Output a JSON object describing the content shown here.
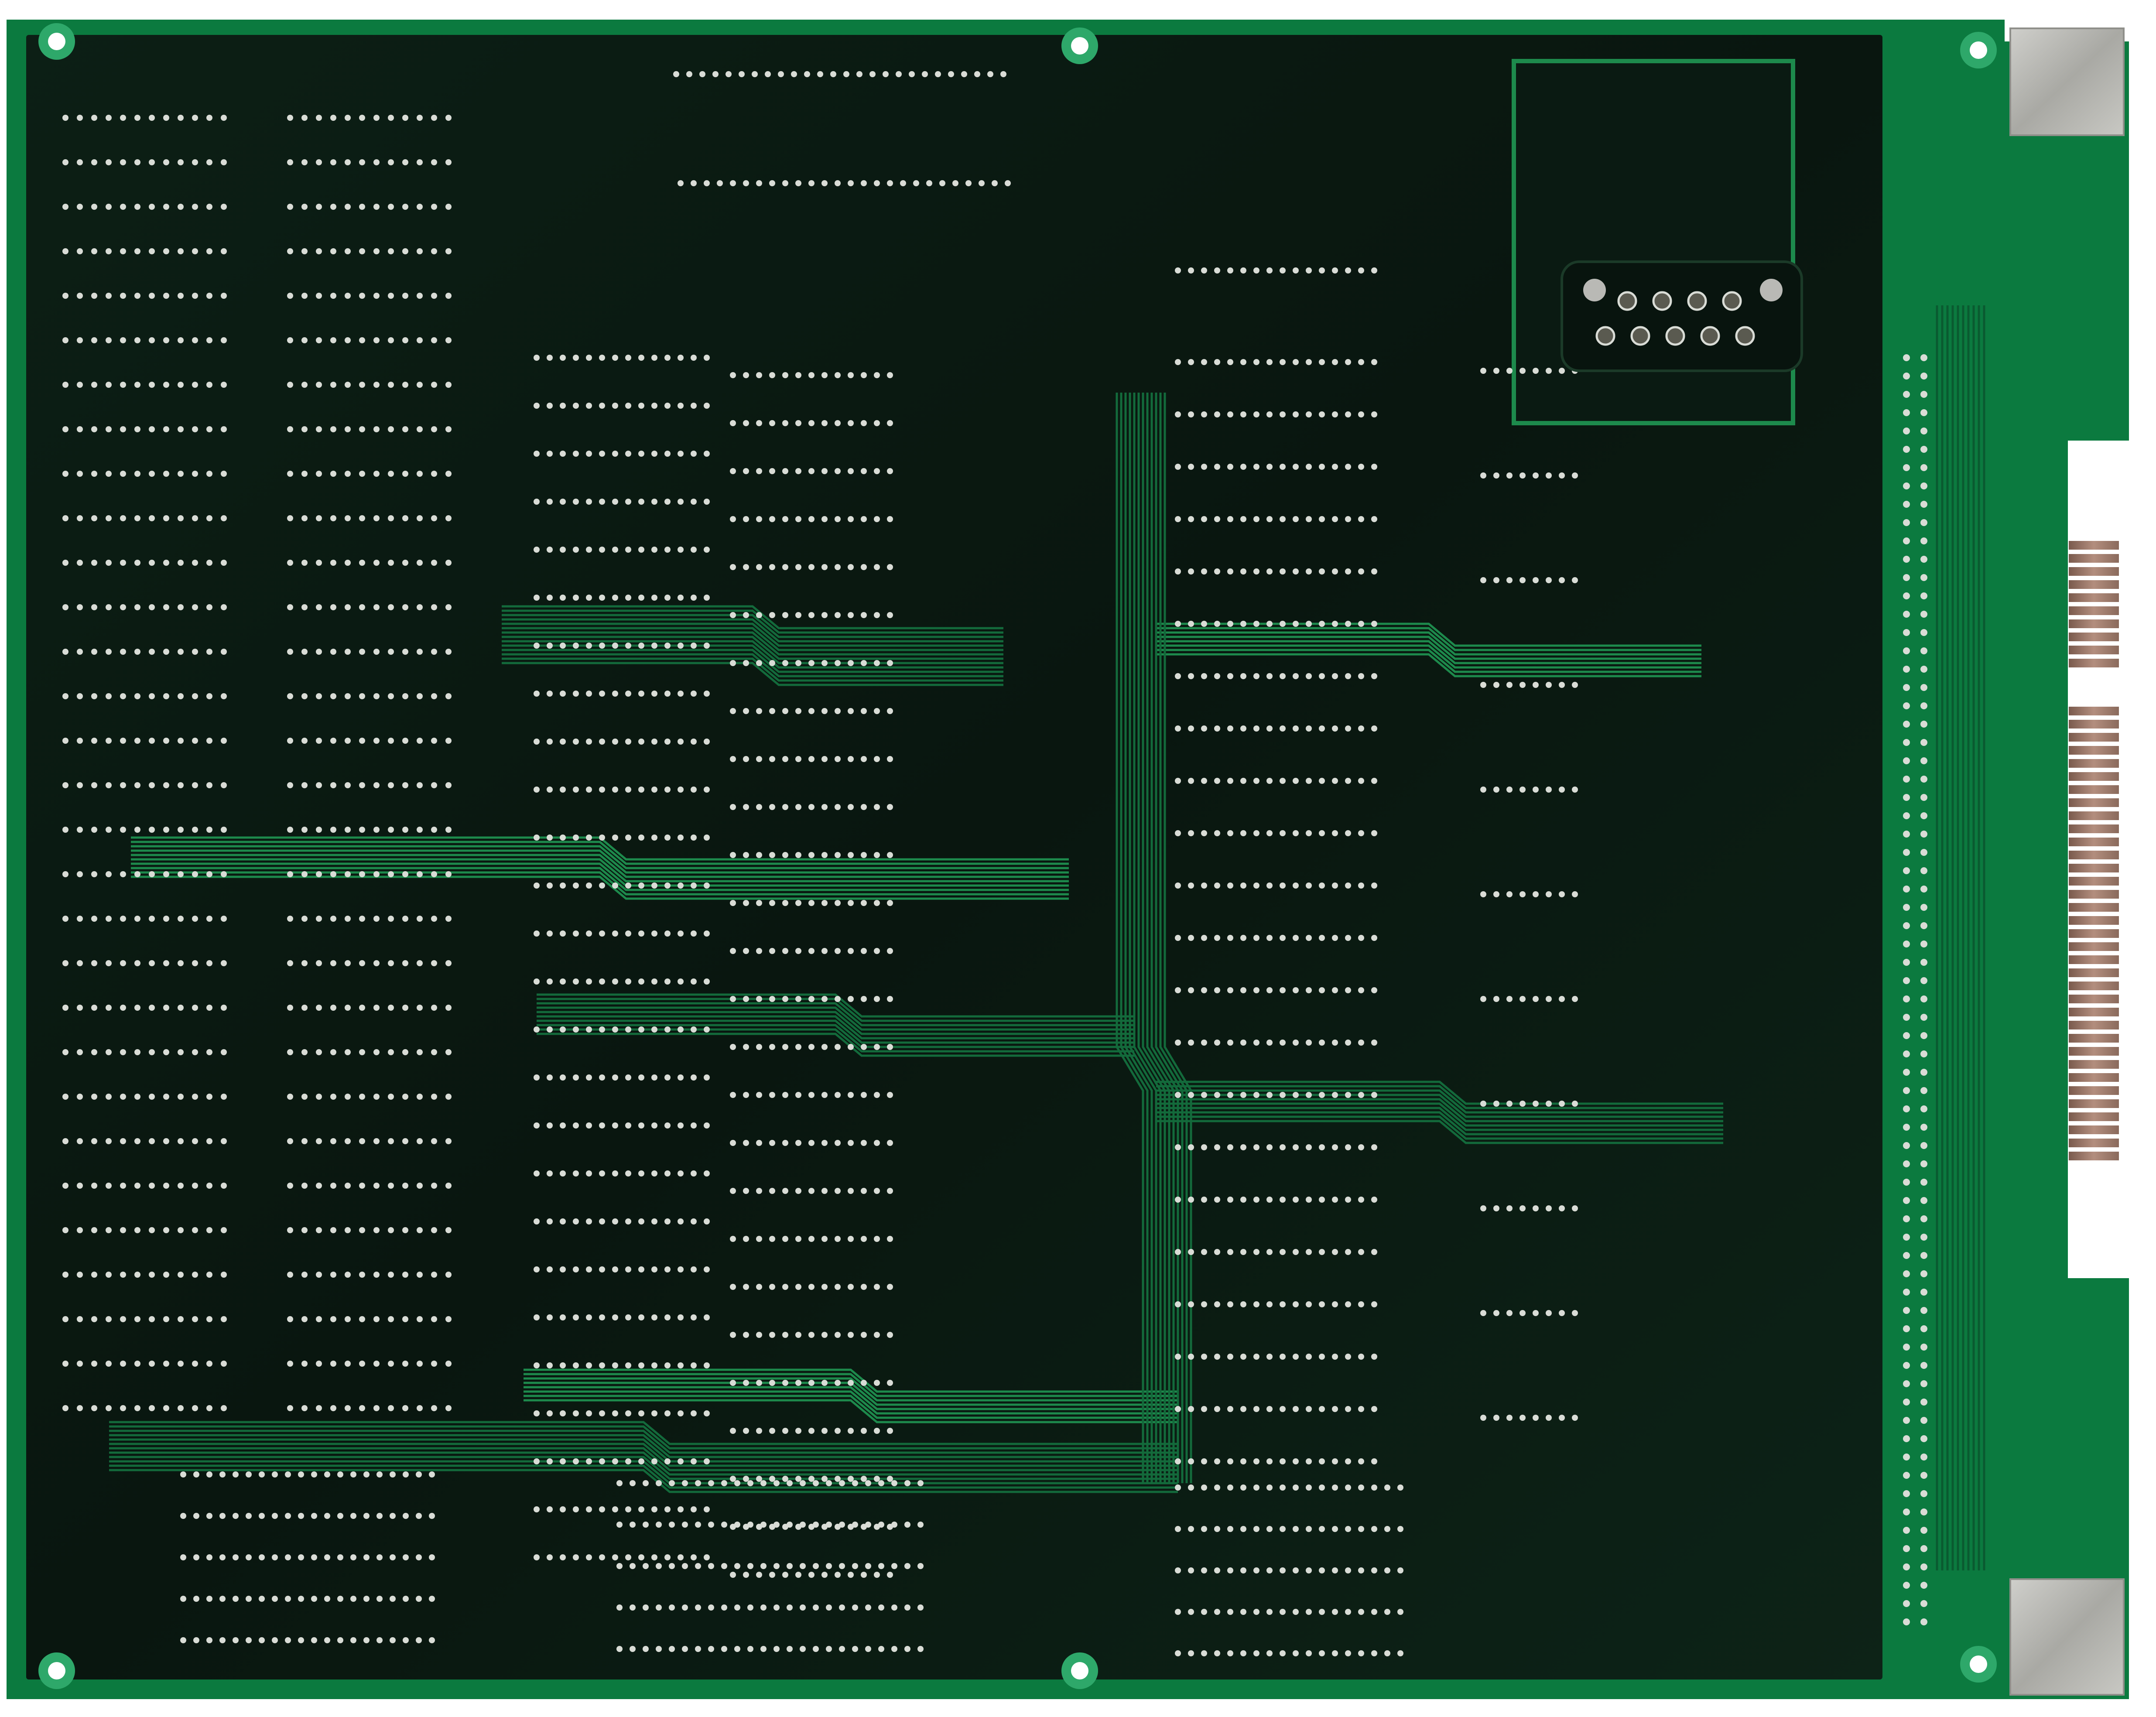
{
  "scene": {
    "subject": "pcb-underside",
    "colors": {
      "background": "#ffffff",
      "board_green": "#0b7a3f",
      "board_dark": "#0b1a13",
      "trace": "#136a3b",
      "trace_bright": "#1d8a4c",
      "pad": "#d9dcd6",
      "metal": "#b9b9b5",
      "gold": "#9c7a6b"
    }
  }
}
